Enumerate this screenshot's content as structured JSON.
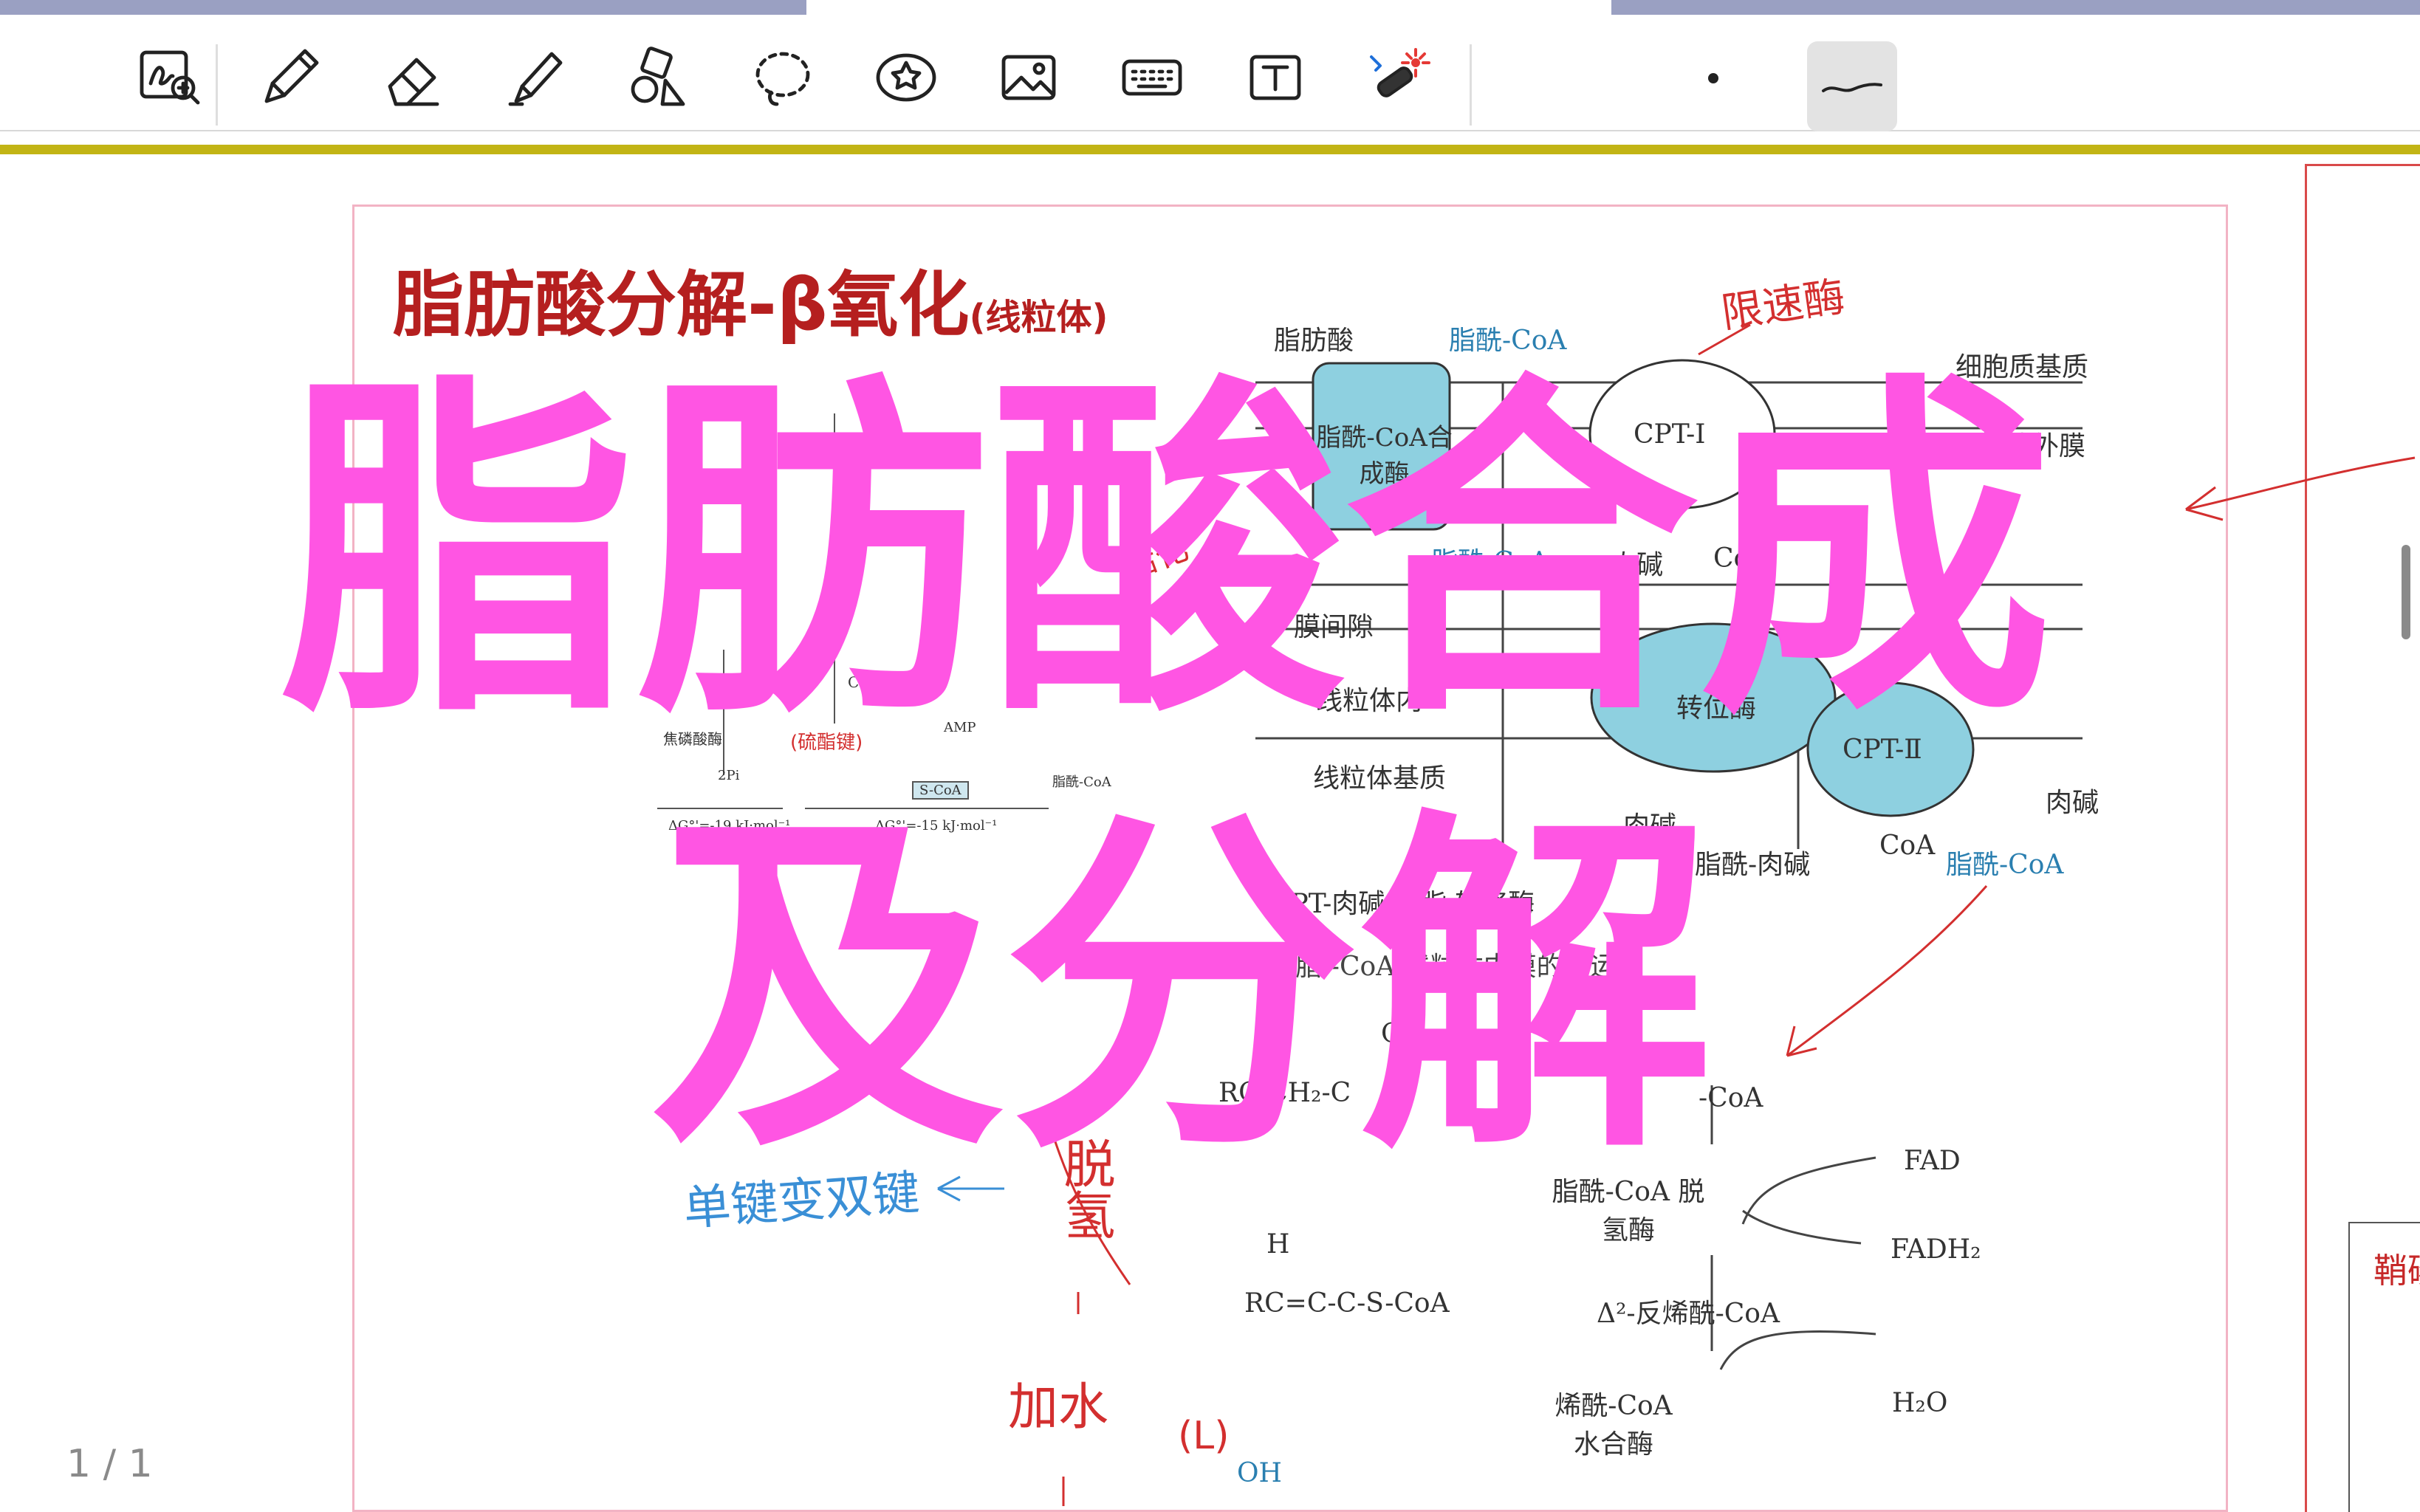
{
  "toolbar": {
    "tools": [
      {
        "name": "lasso-zoom-icon"
      },
      {
        "name": "pen-icon"
      },
      {
        "name": "eraser-icon"
      },
      {
        "name": "highlighter-icon"
      },
      {
        "name": "shapes-icon"
      },
      {
        "name": "lasso-select-icon"
      },
      {
        "name": "sticker-icon"
      },
      {
        "name": "image-icon"
      },
      {
        "name": "keyboard-icon"
      },
      {
        "name": "text-box-icon"
      },
      {
        "name": "laser-pointer-icon"
      }
    ],
    "pen_dot": "dot-size-icon",
    "stroke_style": "stroke-style-icon"
  },
  "slide": {
    "title": "脂肪酸分解-β氧化",
    "title_small": "(线粒体)",
    "labels": {
      "fatty_acid": "脂肪酸",
      "acyl_coa": "脂酰-CoA",
      "cytosol": "细胞质基质",
      "outer_membrane": "粒体外膜",
      "synthase": "脂酰-CoA合成酶",
      "cpt1": "CPT-Ⅰ",
      "acyl_coa_2": "脂酰-CoA",
      "carnitine": "肉碱",
      "coa": "CoA",
      "intermembrane": "膜间隙",
      "inner_membrane": "线粒体内",
      "translocase": "转位酶",
      "cpt2": "CPT-Ⅱ",
      "matrix": "线粒体基质",
      "carnitine_2": "肉碱",
      "carnitine_3": "肉碱",
      "acyl_carnitine": "脂酰-肉碱",
      "coa_2": "CoA",
      "acyl_coa_3": "脂酰-CoA",
      "cpt_shuttle": "CPT-肉碱   入脂   转移酶",
      "figure_caption": "3   脂   -CoA   线粒体内膜的转运",
      "rcch2": "RC  CH₂-C",
      "s_coa": "-CoA",
      "fad": "FAD",
      "fadh2": "FADH₂",
      "dehydrogenase": "脂酰-CoA 脱氢酶",
      "enoyl": "Δ²-反烯酰-CoA",
      "rc_formula": "RC=C-C-S-CoA",
      "hydratase": "烯酰-CoA 水合酶",
      "h2o": "H₂O",
      "oh": "OH",
      "o_mark": "O",
      "h_mark": "H",
      "dg1": "ΔG°'=-19 kJ·mol⁻¹",
      "dg2": "ΔG°'=-15 kJ·mol⁻¹",
      "pyrophosphate": "焦磷酸",
      "pyrophosphatase": "焦磷酸酶",
      "two_pi": "2Pi",
      "coa_sh": "CoA-SH",
      "s_coa_box": "S-CoA",
      "acyl_coa_small": "脂酰-CoA",
      "amp": "AMP"
    }
  },
  "overlay": {
    "line1": "脂肪酸合成",
    "line2": "及分解"
  },
  "annotations": {
    "red_top": "限速酶",
    "red_left": "活化",
    "red_small": "(硫酯键)",
    "blue": "单键变双键",
    "red_tuo": "脱氢",
    "red_jiashui": "加水",
    "red_l": "(L)"
  },
  "right_page_text": "鞘磷",
  "page_indicator": "1 / 1",
  "colors": {
    "overlay": "#ff55e3",
    "title": "#b51f1f",
    "ink_red": "#d32f2f",
    "ink_blue": "#3a8fd6",
    "membrane_protein": "#8ed0e0",
    "accent_line": "#c2b415"
  }
}
